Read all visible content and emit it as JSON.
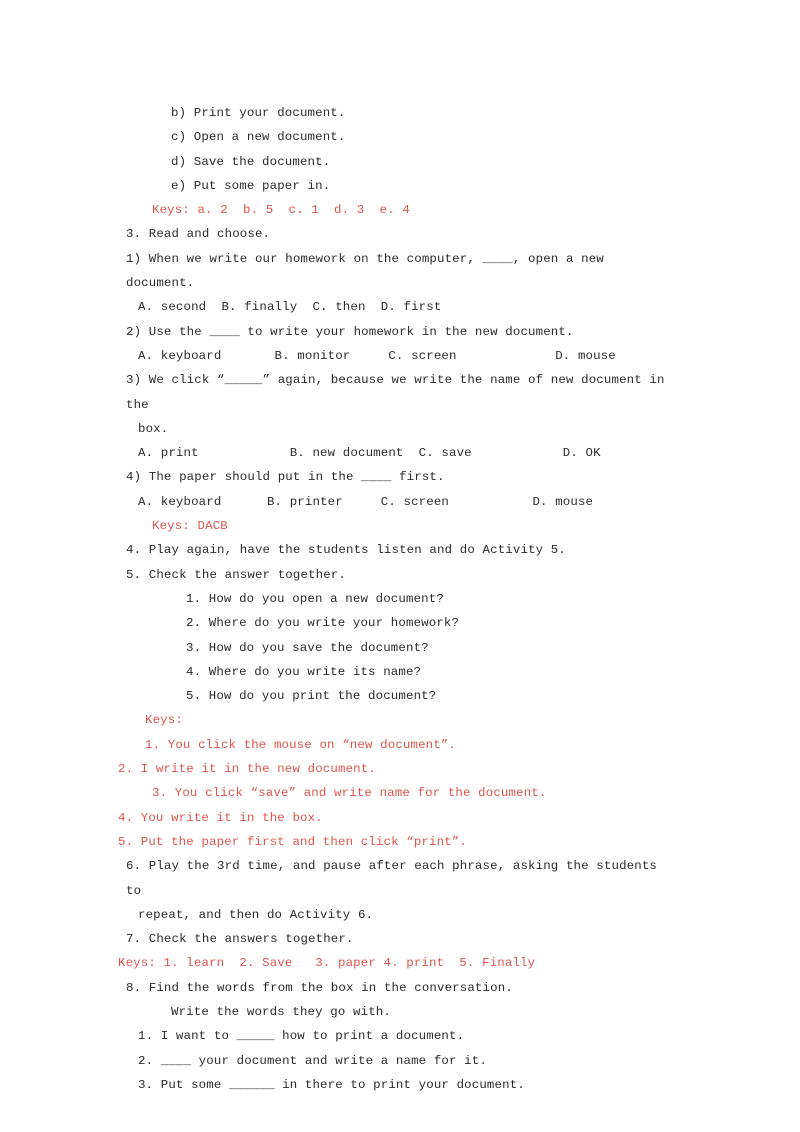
{
  "document": {
    "colors": {
      "text": "#2b2b2b",
      "answer_key_red": "#e0544e",
      "background": "#ffffff"
    },
    "lines": [
      {
        "id": "l01",
        "text": "b) Print your document.",
        "color": "black",
        "indent": "ind-4"
      },
      {
        "id": "l02",
        "text": "c) Open a new document.",
        "color": "black",
        "indent": "ind-4"
      },
      {
        "id": "l03",
        "text": "d) Save the document.",
        "color": "black",
        "indent": "ind-4"
      },
      {
        "id": "l04",
        "text": "e) Put some paper in.",
        "color": "black",
        "indent": "ind-4"
      },
      {
        "id": "l05",
        "text": "Keys: a. 2  b. 5  c. 1  d. 3  e. 4",
        "color": "red",
        "indent": "ind-3"
      },
      {
        "id": "l06",
        "text": "3. Read and choose.",
        "color": "black",
        "indent": "ind-0"
      },
      {
        "id": "l07",
        "text": "1) When we write our homework on the computer, ____, open a new document.",
        "color": "black",
        "indent": "ind-0"
      },
      {
        "id": "l08",
        "text": "A. second  B. finally  C. then  D. first",
        "color": "black",
        "indent": "ind-1"
      },
      {
        "id": "l09",
        "text": "2) Use the ____ to write your homework in the new document.",
        "color": "black",
        "indent": "ind-0"
      },
      {
        "id": "l10",
        "text": "A. keyboard       B. monitor     C. screen             D. mouse",
        "color": "black",
        "indent": "ind-1"
      },
      {
        "id": "l11",
        "text": "3) We click “_____” again, because we write the name of new document in the",
        "color": "black",
        "indent": "ind-0"
      },
      {
        "id": "l12",
        "text": "box.",
        "color": "black",
        "indent": "ind-1"
      },
      {
        "id": "l13",
        "text": "A. print            B. new document  C. save            D. OK",
        "color": "black",
        "indent": "ind-1"
      },
      {
        "id": "l14",
        "text": "4) The paper should put in the ____ first.",
        "color": "black",
        "indent": "ind-0"
      },
      {
        "id": "l15",
        "text": "A. keyboard      B. printer     C. screen           D. mouse",
        "color": "black",
        "indent": "ind-1"
      },
      {
        "id": "l16",
        "text": "Keys: DACB",
        "color": "red",
        "indent": "ind-3"
      },
      {
        "id": "l17",
        "text": "4. Play again, have the students listen and do Activity 5.",
        "color": "black",
        "indent": "ind-0"
      },
      {
        "id": "l18",
        "text": "5. Check the answer together.",
        "color": "black",
        "indent": "ind-0"
      },
      {
        "id": "l19",
        "text": "1. How do you open a new document?",
        "color": "black",
        "indent": "ind-5"
      },
      {
        "id": "l20",
        "text": "2. Where do you write your homework?",
        "color": "black",
        "indent": "ind-5"
      },
      {
        "id": "l21",
        "text": "3. How do you save the document?",
        "color": "black",
        "indent": "ind-5"
      },
      {
        "id": "l22",
        "text": "4. Where do you write its name?",
        "color": "black",
        "indent": "ind-5"
      },
      {
        "id": "l23",
        "text": "5. How do you print the document?",
        "color": "black",
        "indent": "ind-5"
      },
      {
        "id": "l24",
        "text": "Keys:",
        "color": "red",
        "indent": "ind-2"
      },
      {
        "id": "l25",
        "text": "1. You click the mouse on “new document”.",
        "color": "red",
        "indent": "ind-2"
      },
      {
        "id": "l26",
        "text": "2. I write it in the new document.",
        "color": "red",
        "indent": "ind-neg"
      },
      {
        "id": "l27",
        "text": "3. You click “save” and write name for the document.",
        "color": "red",
        "indent": "ind-3"
      },
      {
        "id": "l28",
        "text": "4. You write it in the box.",
        "color": "red",
        "indent": "ind-neg"
      },
      {
        "id": "l29",
        "text": "5. Put the paper first and then click “print”.",
        "color": "red",
        "indent": "ind-neg"
      },
      {
        "id": "l30",
        "text": "6. Play the 3rd time, and pause after each phrase, asking the students to",
        "color": "black",
        "indent": "ind-0"
      },
      {
        "id": "l31",
        "text": "repeat, and then do Activity 6.",
        "color": "black",
        "indent": "ind-1"
      },
      {
        "id": "l32",
        "text": "7. Check the answers together.",
        "color": "black",
        "indent": "ind-0"
      },
      {
        "id": "l33",
        "text": "Keys: 1. learn  2. Save   3. paper 4. print  5. Finally",
        "color": "red",
        "indent": "ind-neg"
      },
      {
        "id": "l34",
        "text": "8. Find the words from the box in the conversation.",
        "color": "black",
        "indent": "ind-0"
      },
      {
        "id": "l35",
        "text": "Write the words they go with.",
        "color": "black",
        "indent": "ind-4"
      },
      {
        "id": "l36",
        "text": "1. I want to _____ how to print a document.",
        "color": "black",
        "indent": "ind-1"
      },
      {
        "id": "l37",
        "text": "2. ____ your document and write a name for it.",
        "color": "black",
        "indent": "ind-1"
      },
      {
        "id": "l38",
        "text": "3. Put some ______ in there to print your document.",
        "color": "black",
        "indent": "ind-1"
      }
    ]
  }
}
